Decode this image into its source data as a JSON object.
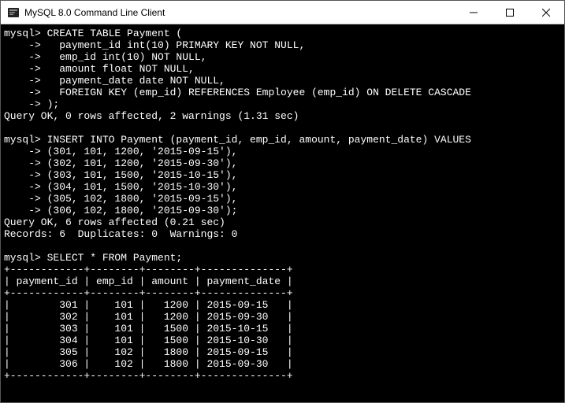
{
  "window": {
    "title": "MySQL 8.0 Command Line Client"
  },
  "terminal": {
    "lines": [
      "mysql> CREATE TABLE Payment (",
      "    ->   payment_id int(10) PRIMARY KEY NOT NULL,",
      "    ->   emp_id int(10) NOT NULL,",
      "    ->   amount float NOT NULL,",
      "    ->   payment_date date NOT NULL,",
      "    ->   FOREIGN KEY (emp_id) REFERENCES Employee (emp_id) ON DELETE CASCADE",
      "    -> );",
      "Query OK, 0 rows affected, 2 warnings (1.31 sec)",
      "",
      "mysql> INSERT INTO Payment (payment_id, emp_id, amount, payment_date) VALUES",
      "    -> (301, 101, 1200, '2015-09-15'),",
      "    -> (302, 101, 1200, '2015-09-30'),",
      "    -> (303, 101, 1500, '2015-10-15'),",
      "    -> (304, 101, 1500, '2015-10-30'),",
      "    -> (305, 102, 1800, '2015-09-15'),",
      "    -> (306, 102, 1800, '2015-09-30');",
      "Query OK, 6 rows affected (0.21 sec)",
      "Records: 6  Duplicates: 0  Warnings: 0",
      "",
      "mysql> SELECT * FROM Payment;",
      "+------------+--------+--------+--------------+",
      "| payment_id | emp_id | amount | payment_date |",
      "+------------+--------+--------+--------------+",
      "|        301 |    101 |   1200 | 2015-09-15   |",
      "|        302 |    101 |   1200 | 2015-09-30   |",
      "|        303 |    101 |   1500 | 2015-10-15   |",
      "|        304 |    101 |   1500 | 2015-10-30   |",
      "|        305 |    102 |   1800 | 2015-09-15   |",
      "|        306 |    102 |   1800 | 2015-09-30   |",
      "+------------+--------+--------+--------------+"
    ]
  },
  "chart_data": {
    "type": "table",
    "title": "Payment",
    "columns": [
      "payment_id",
      "emp_id",
      "amount",
      "payment_date"
    ],
    "rows": [
      [
        301,
        101,
        1200,
        "2015-09-15"
      ],
      [
        302,
        101,
        1200,
        "2015-09-30"
      ],
      [
        303,
        101,
        1500,
        "2015-10-15"
      ],
      [
        304,
        101,
        1500,
        "2015-10-30"
      ],
      [
        305,
        102,
        1800,
        "2015-09-15"
      ],
      [
        306,
        102,
        1800,
        "2015-09-30"
      ]
    ]
  }
}
